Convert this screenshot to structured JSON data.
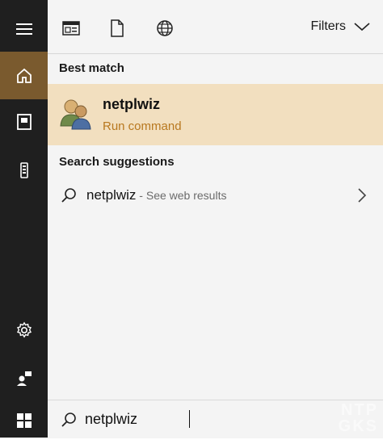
{
  "rail": {
    "items": [
      {
        "icon": "hamburger-menu-icon"
      },
      {
        "icon": "home-icon",
        "active": true
      },
      {
        "icon": "notebook-icon"
      },
      {
        "icon": "phone-tower-icon"
      },
      {
        "icon": "gear-icon"
      },
      {
        "icon": "user-feedback-icon"
      },
      {
        "icon": "windows-start-icon"
      }
    ]
  },
  "topbar": {
    "filters_label": "Filters",
    "icons": [
      "apps-icon",
      "document-icon",
      "web-globe-icon"
    ]
  },
  "results": {
    "best_match_label": "Best match",
    "best_match": {
      "title": "netplwiz",
      "subtitle": "Run command"
    },
    "suggestions_label": "Search suggestions",
    "suggestion": {
      "query": "netplwiz",
      "hint": " - See web results"
    }
  },
  "search": {
    "value": "netplwiz"
  },
  "watermark": {
    "line1": "NTP",
    "line2": "GKS"
  },
  "colors": {
    "rail_bg": "#1f1f1f",
    "active_rail": "#7a5a2e",
    "best_match_bg": "#f2dfbf",
    "subtitle": "#b8781f"
  }
}
